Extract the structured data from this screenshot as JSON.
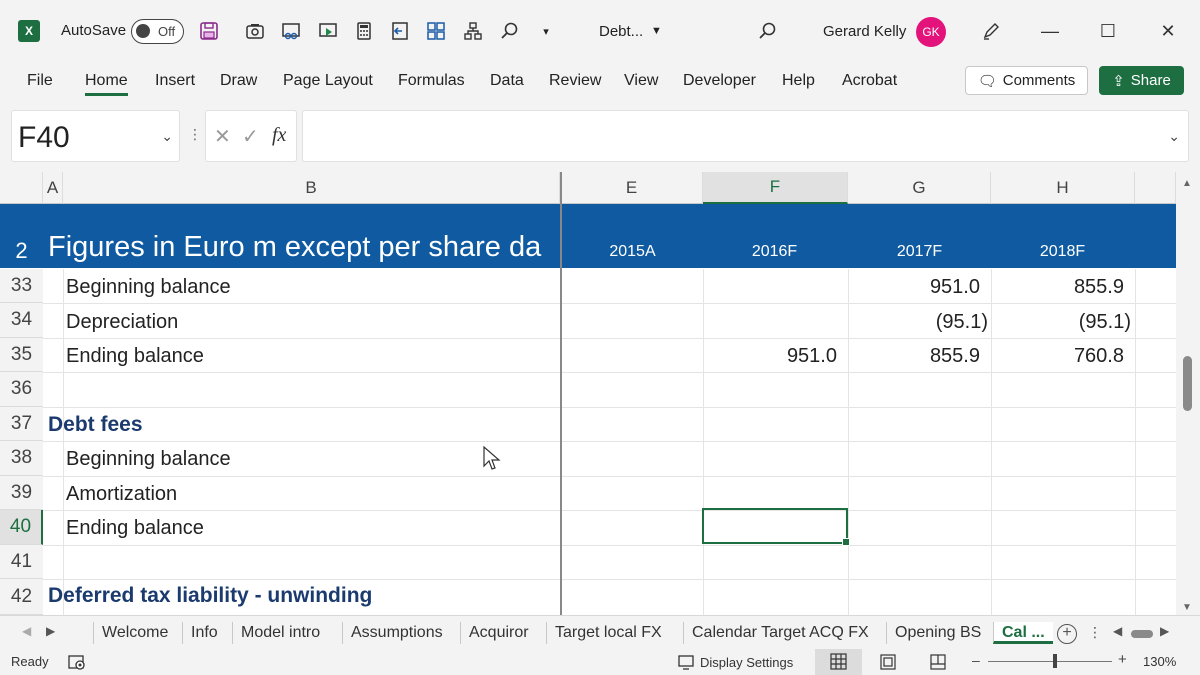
{
  "titlebar": {
    "logo": "X",
    "autosave_label": "AutoSave",
    "autosave_state": "Off",
    "doc_name": "Debt...",
    "user_name": "Gerard Kelly",
    "user_initials": "GK",
    "accent": "#1d6f42",
    "avatar_color": "#e3137b"
  },
  "menu": {
    "items": [
      "File",
      "Home",
      "Insert",
      "Draw",
      "Page Layout",
      "Formulas",
      "Data",
      "Review",
      "View",
      "Developer",
      "Help",
      "Acrobat"
    ],
    "active": "Home",
    "comments_label": "Comments",
    "share_label": "Share"
  },
  "formula_bar": {
    "name_box": "F40",
    "fx": "fx",
    "formula": ""
  },
  "columns": [
    "A",
    "B",
    "E",
    "F",
    "G",
    "H"
  ],
  "header_row": {
    "number": "2",
    "title": "Figures in Euro m except per share da",
    "years": [
      "2015A",
      "2016F",
      "2017F",
      "2018F"
    ],
    "color": "#0f5aa0"
  },
  "rows": [
    {
      "num": "33",
      "label": "Beginning balance",
      "bold": false,
      "E": "",
      "F": "",
      "G": "951.0",
      "H": "855.9"
    },
    {
      "num": "34",
      "label": "Depreciation",
      "bold": false,
      "E": "",
      "F": "",
      "G": "(95.1)",
      "H": "(95.1)"
    },
    {
      "num": "35",
      "label": "Ending balance",
      "bold": false,
      "E": "",
      "F": "951.0",
      "G": "855.9",
      "H": "760.8"
    },
    {
      "num": "36",
      "label": "",
      "bold": false,
      "E": "",
      "F": "",
      "G": "",
      "H": ""
    },
    {
      "num": "37",
      "label": "Debt fees",
      "bold": true,
      "E": "",
      "F": "",
      "G": "",
      "H": ""
    },
    {
      "num": "38",
      "label": "Beginning balance",
      "bold": false,
      "E": "",
      "F": "",
      "G": "",
      "H": ""
    },
    {
      "num": "39",
      "label": "Amortization",
      "bold": false,
      "E": "",
      "F": "",
      "G": "",
      "H": ""
    },
    {
      "num": "40",
      "label": "Ending balance",
      "bold": false,
      "E": "",
      "F": "",
      "G": "",
      "H": ""
    },
    {
      "num": "41",
      "label": "",
      "bold": false,
      "E": "",
      "F": "",
      "G": "",
      "H": ""
    },
    {
      "num": "42",
      "label": "Deferred tax liability - unwinding",
      "bold": true,
      "E": "",
      "F": "",
      "G": "",
      "H": ""
    }
  ],
  "sheet_tabs": [
    "Welcome",
    "Info",
    "Model intro",
    "Assumptions",
    "Acquiror",
    "Target local FX",
    "Calendar Target ACQ FX",
    "Opening BS",
    "Cal ..."
  ],
  "active_tab": "Cal ...",
  "status": {
    "ready": "Ready",
    "display_settings": "Display Settings",
    "zoom": "130%"
  }
}
